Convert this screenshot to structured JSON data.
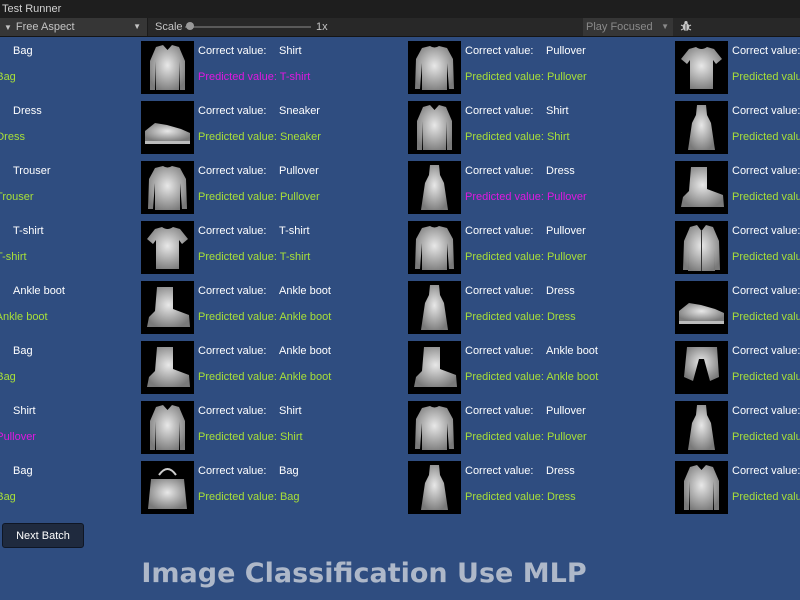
{
  "window": {
    "title": "Test Runner"
  },
  "toolbar": {
    "aspect": "Free Aspect",
    "scale_label": "Scale",
    "scale_value": "1x",
    "play_mode": "Play Focused",
    "bug_icon": "bug-icon"
  },
  "colors": {
    "background": "#2f4d80",
    "correct": "#a8e038",
    "wrong": "#e018e0"
  },
  "labels": {
    "correct_prefix": "Correct value:",
    "predicted_prefix": "Predicted value: "
  },
  "left_column": [
    {
      "true": "Bag",
      "pred": "e: Bag",
      "correct": true
    },
    {
      "true": "Dress",
      "pred": "e: Dress",
      "correct": true
    },
    {
      "true": "Trouser",
      "pred": "e: Trouser",
      "correct": true
    },
    {
      "true": "T-shirt",
      "pred": "e: T-shirt",
      "correct": true
    },
    {
      "true": "Ankle boot",
      "pred": "e: Ankle boot",
      "correct": true
    },
    {
      "true": "Bag",
      "pred": "e: Bag",
      "correct": true
    },
    {
      "true": "Shirt",
      "pred": "e: Pullover",
      "correct": false
    },
    {
      "true": "Bag",
      "pred": "e: Bag",
      "correct": true
    }
  ],
  "columns": [
    [
      {
        "true": "Shirt",
        "pred": "T-shirt",
        "correct": false,
        "icon": "shirt-image"
      },
      {
        "true": "Sneaker",
        "pred": "Sneaker",
        "correct": true,
        "icon": "sneaker-image"
      },
      {
        "true": "Pullover",
        "pred": "Pullover",
        "correct": true,
        "icon": "pullover-image"
      },
      {
        "true": "T-shirt",
        "pred": "T-shirt",
        "correct": true,
        "icon": "tshirt-image"
      },
      {
        "true": "Ankle boot",
        "pred": "Ankle boot",
        "correct": true,
        "icon": "ankle-boot-image"
      },
      {
        "true": "Ankle boot",
        "pred": "Ankle boot",
        "correct": true,
        "icon": "ankle-boot-image"
      },
      {
        "true": "Shirt",
        "pred": "Shirt",
        "correct": true,
        "icon": "shirt-image"
      },
      {
        "true": "Bag",
        "pred": "Bag",
        "correct": true,
        "icon": "bag-image"
      }
    ],
    [
      {
        "true": "Pullover",
        "pred": "Pullover",
        "correct": true,
        "icon": "pullover-image"
      },
      {
        "true": "Shirt",
        "pred": "Shirt",
        "correct": true,
        "icon": "shirt-image"
      },
      {
        "true": "Dress",
        "pred": "Pullover",
        "correct": false,
        "icon": "dress-image"
      },
      {
        "true": "Pullover",
        "pred": "Pullover",
        "correct": true,
        "icon": "pullover-image"
      },
      {
        "true": "Dress",
        "pred": "Dress",
        "correct": true,
        "icon": "dress-image"
      },
      {
        "true": "Ankle boot",
        "pred": "Ankle boot",
        "correct": true,
        "icon": "ankle-boot-image"
      },
      {
        "true": "Pullover",
        "pred": "Pullover",
        "correct": true,
        "icon": "pullover-image"
      },
      {
        "true": "Dress",
        "pred": "Dress",
        "correct": true,
        "icon": "dress-image"
      }
    ],
    [
      {
        "true": "",
        "pred": "",
        "correct": true,
        "icon": "tshirt-image"
      },
      {
        "true": "",
        "pred": "",
        "correct": true,
        "icon": "dress-image"
      },
      {
        "true": "",
        "pred": "",
        "correct": true,
        "icon": "ankle-boot-image"
      },
      {
        "true": "",
        "pred": "",
        "correct": true,
        "icon": "coat-image"
      },
      {
        "true": "",
        "pred": "",
        "correct": true,
        "icon": "sneaker-image"
      },
      {
        "true": "",
        "pred": "",
        "correct": true,
        "icon": "trouser-image"
      },
      {
        "true": "",
        "pred": "",
        "correct": true,
        "icon": "dress-image"
      },
      {
        "true": "",
        "pred": "",
        "correct": true,
        "icon": "shirt-image"
      }
    ]
  ],
  "next_batch_label": "Next Batch",
  "page_title": "Image Classification Use MLP"
}
